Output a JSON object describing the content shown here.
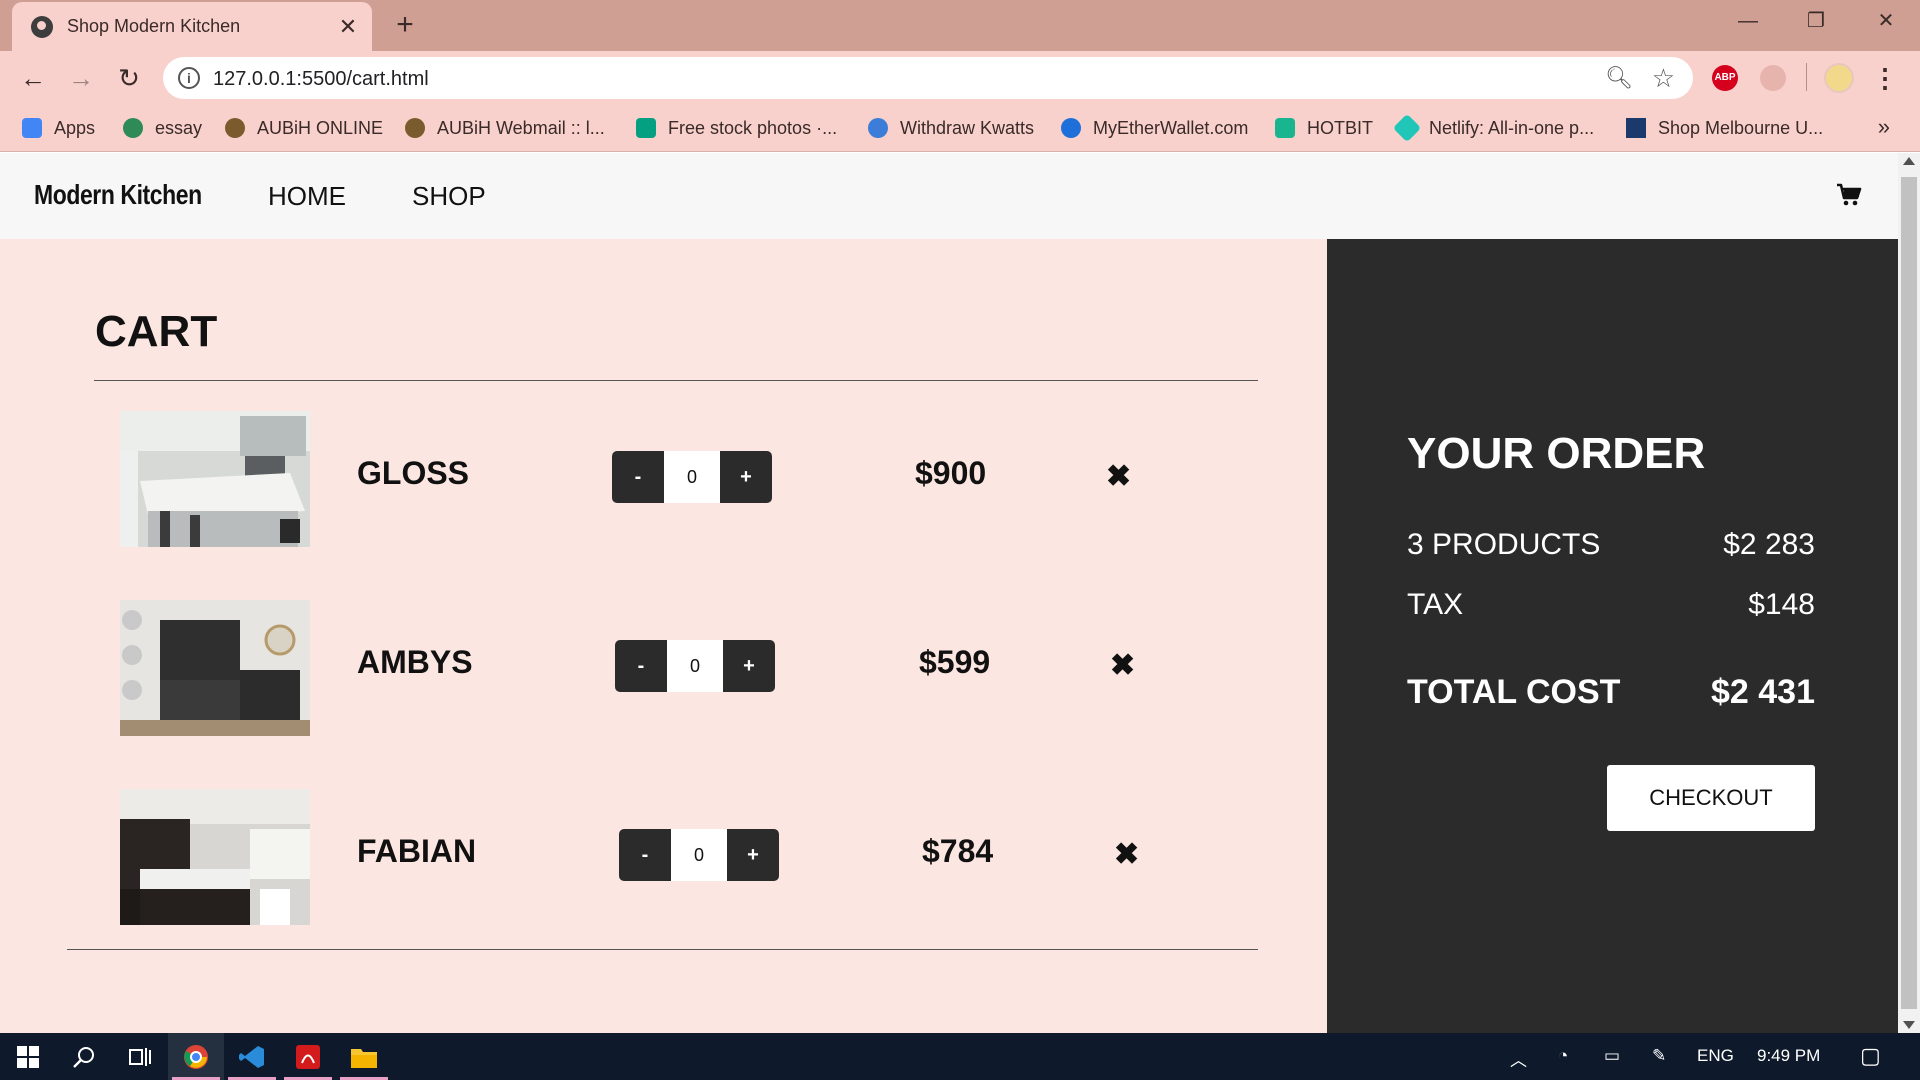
{
  "browser": {
    "tab_title": "Shop Modern Kitchen",
    "tab_close": "✕",
    "new_tab": "+",
    "url": "127.0.0.1:5500/cart.html",
    "window_controls": {
      "minimize": "—",
      "restore": "❐",
      "close": "✕"
    },
    "extensions": {
      "abp": "ABP"
    },
    "bookmarks": [
      {
        "label": "Apps",
        "color": "#4285f4"
      },
      {
        "label": "essay",
        "color": "#2e8b57"
      },
      {
        "label": "AUBiH ONLINE",
        "color": "#7a5b2e"
      },
      {
        "label": "AUBiH Webmail :: l...",
        "color": "#7a5b2e"
      },
      {
        "label": "Free stock photos ·...",
        "color": "#05a081"
      },
      {
        "label": "Withdraw Kwatts",
        "color": "#3c7dd9"
      },
      {
        "label": "MyEtherWallet.com",
        "color": "#1e6fd9"
      },
      {
        "label": "HOTBIT",
        "color": "#19b58f"
      },
      {
        "label": "Netlify: All-in-one p...",
        "color": "#20c6b7"
      },
      {
        "label": "Shop Melbourne U...",
        "color": "#1b3a6b"
      }
    ],
    "bookmarks_more": "»"
  },
  "site": {
    "brand": "Modern Kitchen",
    "nav": {
      "home": "HOME",
      "shop": "SHOP"
    }
  },
  "cart": {
    "title": "CART",
    "items": [
      {
        "name": "GLOSS",
        "quantity": "0",
        "price": "$900",
        "minus": "-",
        "plus": "+",
        "remove": "✖"
      },
      {
        "name": "AMBYS",
        "quantity": "0",
        "price": "$599",
        "minus": "-",
        "plus": "+",
        "remove": "✖"
      },
      {
        "name": "FABIAN",
        "quantity": "0",
        "price": "$784",
        "minus": "-",
        "plus": "+",
        "remove": "✖"
      }
    ]
  },
  "order": {
    "title": "YOUR ORDER",
    "products_label": "3 PRODUCTS",
    "products_value": "$2 283",
    "tax_label": "TAX",
    "tax_value": "$148",
    "total_label": "TOTAL COST",
    "total_value": "$2 431",
    "checkout": "CHECKOUT"
  },
  "taskbar": {
    "language": "ENG",
    "time": "9:49 PM"
  },
  "colors": {
    "page_bg": "#fbe6e1",
    "panel_bg": "#2b2b2b",
    "tab_bar": "#cf9f94",
    "toolbar": "#f8d1cc"
  }
}
